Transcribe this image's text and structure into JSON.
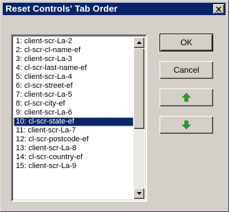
{
  "window": {
    "title": "Reset Controls' Tab Order",
    "close_glyph": "✕"
  },
  "list": {
    "items": [
      "1: client-scr-La-2",
      "2: cl-scr-cl-name-ef",
      "3: client-scr-La-3",
      "4: cl-scr-last-name-ef",
      "5: client-scr-La-4",
      "6: cl-scr-street-ef",
      "7: client-scr-La-5",
      "8: cl-scr-city-ef",
      "9: client-scr-La-6",
      "10: cl-scr-state-ef",
      "11: client-scr-La-7",
      "12: cl-scr-postcode-ef",
      "13: client-scr-La-8",
      "14: cl-scr-country-ef",
      "15: client-scr-La-9"
    ],
    "selected_index": 9
  },
  "buttons": {
    "ok_label": "OK",
    "cancel_label": "Cancel",
    "move_up_icon": "green-up-arrow-icon",
    "move_down_icon": "green-down-arrow-icon"
  },
  "colors": {
    "title_bar": "#0a246a",
    "selection": "#0a246a",
    "arrow_green": "#2e9a2e"
  }
}
